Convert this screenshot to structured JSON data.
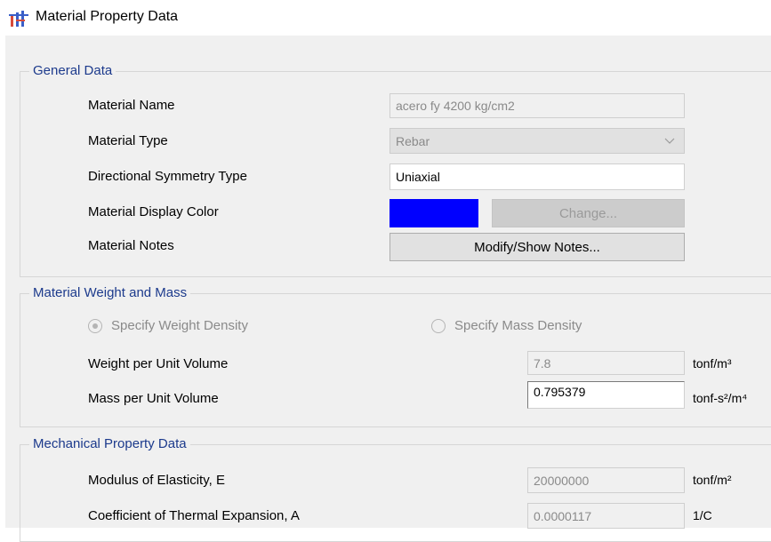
{
  "window": {
    "title": "Material Property Data"
  },
  "general": {
    "group_label": "General Data",
    "name_label": "Material Name",
    "name_value": "acero fy 4200 kg/cm2",
    "type_label": "Material Type",
    "type_value": "Rebar",
    "symmetry_label": "Directional Symmetry Type",
    "symmetry_value": "Uniaxial",
    "color_label": "Material Display Color",
    "display_color": "#0000ff",
    "change_button": "Change...",
    "notes_label": "Material Notes",
    "notes_button": "Modify/Show Notes..."
  },
  "weight_mass": {
    "group_label": "Material Weight and Mass",
    "radio_weight": "Specify Weight Density",
    "radio_weight_checked": true,
    "radio_mass": "Specify Mass Density",
    "radio_mass_checked": false,
    "weight_label": "Weight per Unit Volume",
    "weight_value": "7.8",
    "weight_unit": "tonf/m³",
    "mass_label": "Mass per Unit Volume",
    "mass_value": "0.795379",
    "mass_unit": "tonf-s²/m⁴"
  },
  "mechanical": {
    "group_label": "Mechanical Property Data",
    "modulus_label": "Modulus of Elasticity,  E",
    "modulus_value": "20000000",
    "modulus_unit": "tonf/m²",
    "thermal_label": "Coefficient of Thermal Expansion,  A",
    "thermal_value": "0.0000117",
    "thermal_unit": "1/C"
  }
}
